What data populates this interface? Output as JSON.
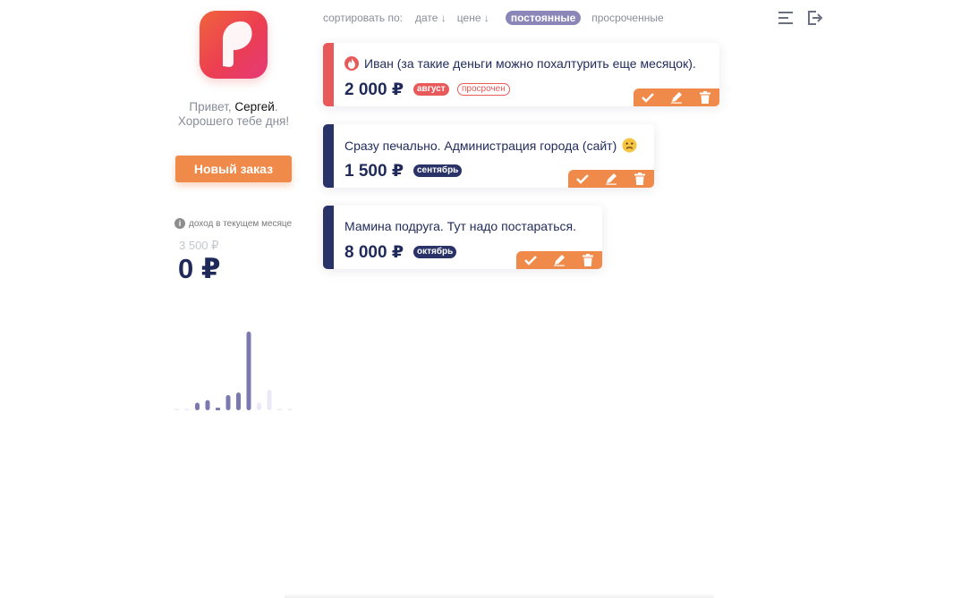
{
  "sidebar": {
    "greeting_prefix": "Привет, ",
    "user_name": "Сергей",
    "greeting_suffix": ".",
    "greeting_line2": "Хорошего тебе дня!",
    "new_order_label": "Новый заказ",
    "income_label": "доход в текущем месяце",
    "income_prev": "3 500 ₽",
    "income_current": "0 ₽",
    "chart_data": {
      "type": "bar",
      "values": [
        0,
        0,
        3,
        4,
        1,
        6,
        7,
        31,
        3,
        8,
        0,
        0
      ],
      "series_colors": [
        "#ebe9f6",
        "#ebe9f6",
        "#7c78b0",
        "#7c78b0",
        "#7c78b0",
        "#7c78b0",
        "#7c78b0",
        "#7c78b0",
        "#ebe9f6",
        "#ebe9f6",
        "#ebe9f6",
        "#ebe9f6"
      ],
      "title": "",
      "xlabel": "",
      "ylabel": ""
    }
  },
  "sort": {
    "label": "сортировать по:",
    "options": [
      {
        "label": "дате ↓"
      },
      {
        "label": "цене ↓"
      },
      {
        "label": "постоянные"
      },
      {
        "label": "просроченные"
      }
    ]
  },
  "orders": [
    {
      "title": "Иван (за такие деньги можно похалтурить еще месяцок).",
      "amount": "2 000 ₽",
      "month": "август",
      "status": "просрочен",
      "stripe_color": "#e85a5a"
    },
    {
      "title": "Сразу печально. Администрация города (сайт)",
      "amount": "1 500 ₽",
      "month": "сентябрь",
      "stripe_color": "#2a3368"
    },
    {
      "title": "Мамина подруга. Тут надо постараться.",
      "amount": "8 000 ₽",
      "month": "октябрь",
      "stripe_color": "#2a3368"
    }
  ],
  "icons": {
    "menu": "menu-icon",
    "logout": "logout-icon",
    "done": "check-icon",
    "edit": "pencil-icon",
    "delete": "trash-icon",
    "hot": "fire-icon",
    "sad": "sad-face-icon"
  },
  "colors": {
    "accent_orange": "#f08a4b",
    "danger_red": "#e85a5a",
    "navy": "#2a3368",
    "sort_active": "#8a86b8"
  }
}
